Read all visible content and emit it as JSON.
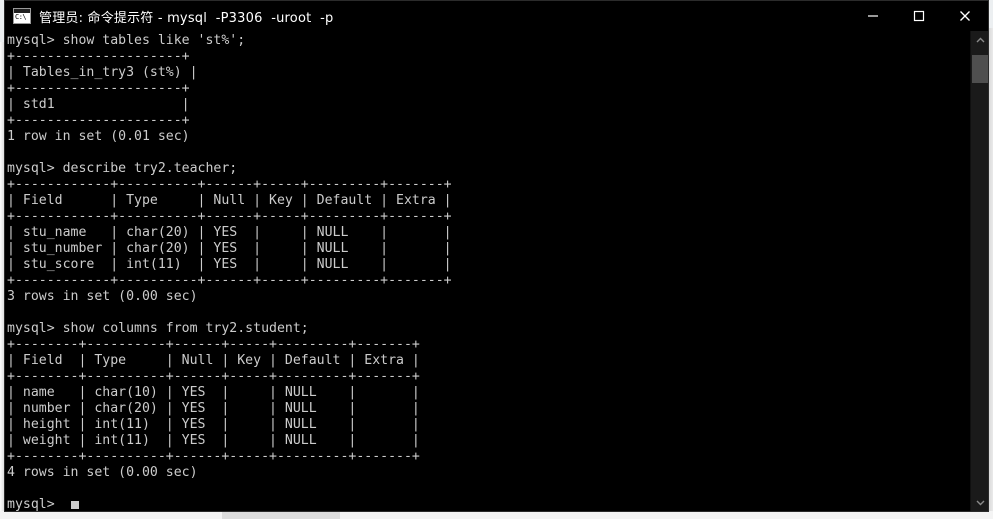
{
  "window": {
    "title": "管理员: 命令提示符 - mysql  -P3306  -uroot  -p",
    "icon_name": "cmd-icon",
    "icon_text": "C:\\",
    "controls": {
      "minimize_label": "Minimize",
      "maximize_label": "Maximize",
      "close_label": "Close"
    }
  },
  "scrollbar": {
    "up_arrow_label": "Scroll up",
    "down_arrow_label": "Scroll down"
  },
  "terminal": {
    "foreground_color": "#cccccc",
    "background_color": "#000000",
    "prompt": "mysql>",
    "cursor_visible": true,
    "content": "mysql> show tables like 'st%';\n+---------------------+\n| Tables_in_try3 (st%) |\n+---------------------+\n| std1                |\n+---------------------+\n1 row in set (0.01 sec)\n\nmysql> describe try2.teacher;\n+------------+----------+------+-----+---------+-------+\n| Field      | Type     | Null | Key | Default | Extra |\n+------------+----------+------+-----+---------+-------+\n| stu_name   | char(20) | YES  |     | NULL    |       |\n| stu_number | char(20) | YES  |     | NULL    |       |\n| stu_score  | int(11)  | YES  |     | NULL    |       |\n+------------+----------+------+-----+---------+-------+\n3 rows in set (0.00 sec)\n\nmysql> show columns from try2.student;\n+--------+----------+------+-----+---------+-------+\n| Field  | Type     | Null | Key | Default | Extra |\n+--------+----------+------+-----+---------+-------+\n| name   | char(10) | YES  |     | NULL    |       |\n| number | char(20) | YES  |     | NULL    |       |\n| height | int(11)  | YES  |     | NULL    |       |\n| weight | int(11)  | YES  |     | NULL    |       |\n+--------+----------+------+-----+---------+-------+\n4 rows in set (0.00 sec)\n\nmysql> ",
    "blocks": [
      {
        "command": "show tables like 'st%';",
        "result_type": "table",
        "columns": [
          "Tables_in_try3 (st%)"
        ],
        "rows": [
          [
            "std1"
          ]
        ],
        "status": "1 row in set (0.01 sec)"
      },
      {
        "command": "describe try2.teacher;",
        "result_type": "table",
        "columns": [
          "Field",
          "Type",
          "Null",
          "Key",
          "Default",
          "Extra"
        ],
        "rows": [
          [
            "stu_name",
            "char(20)",
            "YES",
            "",
            "NULL",
            ""
          ],
          [
            "stu_number",
            "char(20)",
            "YES",
            "",
            "NULL",
            ""
          ],
          [
            "stu_score",
            "int(11)",
            "YES",
            "",
            "NULL",
            ""
          ]
        ],
        "status": "3 rows in set (0.00 sec)"
      },
      {
        "command": "show columns from try2.student;",
        "result_type": "table",
        "columns": [
          "Field",
          "Type",
          "Null",
          "Key",
          "Default",
          "Extra"
        ],
        "rows": [
          [
            "name",
            "char(10)",
            "YES",
            "",
            "NULL",
            ""
          ],
          [
            "number",
            "char(20)",
            "YES",
            "",
            "NULL",
            ""
          ],
          [
            "height",
            "int(11)",
            "YES",
            "",
            "NULL",
            ""
          ],
          [
            "weight",
            "int(11)",
            "YES",
            "",
            "NULL",
            ""
          ]
        ],
        "status": "4 rows in set (0.00 sec)"
      }
    ]
  }
}
